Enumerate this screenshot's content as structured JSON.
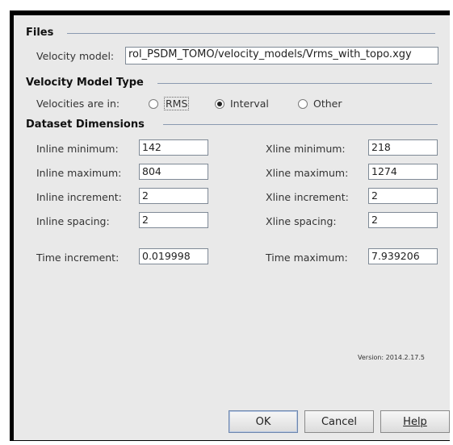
{
  "files": {
    "section_title": "Files",
    "velocity_model_label": "Velocity model:",
    "velocity_model_value": "rol_PSDM_TOMO/velocity_models/Vrms_with_topo.xgy"
  },
  "velocity_type": {
    "section_title": "Velocity Model Type",
    "prompt": "Velocities are in:",
    "options": [
      "RMS",
      "Interval",
      "Other"
    ],
    "selected": "Interval"
  },
  "dimensions": {
    "section_title": "Dataset Dimensions",
    "inline_minimum_label": "Inline minimum:",
    "inline_minimum_value": "142",
    "inline_maximum_label": "Inline maximum:",
    "inline_maximum_value": "804",
    "inline_increment_label": "Inline increment:",
    "inline_increment_value": "2",
    "inline_spacing_label": "Inline spacing:",
    "inline_spacing_value": "2",
    "xline_minimum_label": "Xline minimum:",
    "xline_minimum_value": "218",
    "xline_maximum_label": "Xline maximum:",
    "xline_maximum_value": "1274",
    "xline_increment_label": "Xline increment:",
    "xline_increment_value": "2",
    "xline_spacing_label": "Xline spacing:",
    "xline_spacing_value": "2",
    "time_increment_label": "Time increment:",
    "time_increment_value": "0.019998",
    "time_maximum_label": "Time maximum:",
    "time_maximum_value": "7.939206"
  },
  "version": "Version: 2014.2.17.5",
  "buttons": {
    "ok": "OK",
    "cancel": "Cancel",
    "help": "Help"
  }
}
